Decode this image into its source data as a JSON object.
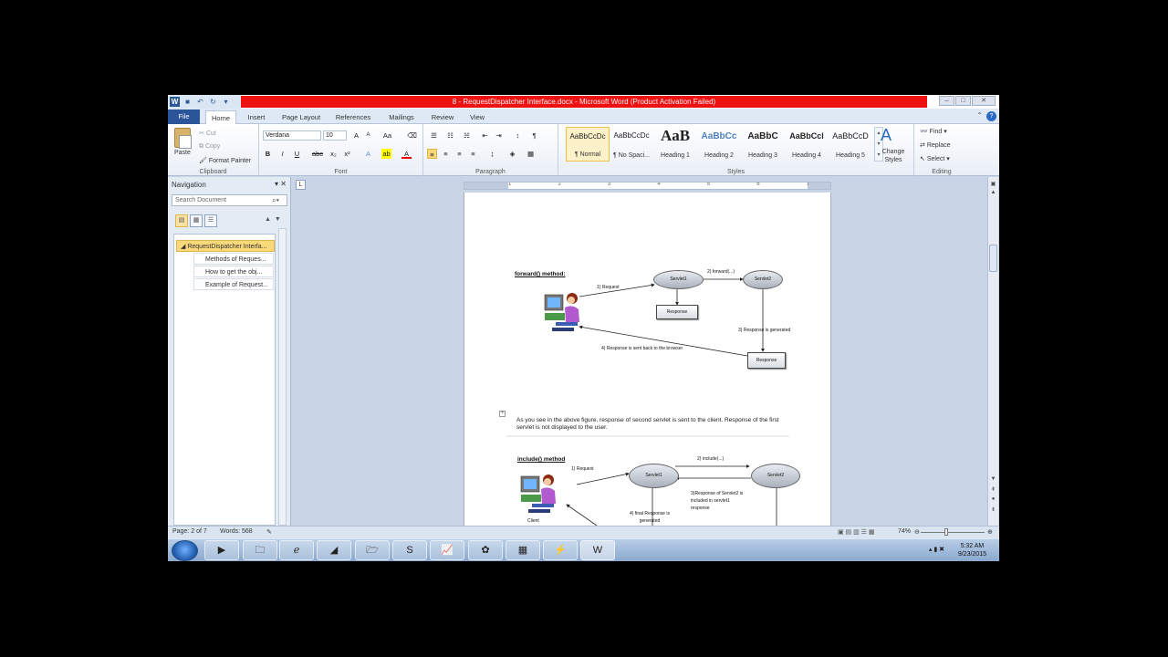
{
  "window": {
    "title": "8 - RequestDispatcher Interface.docx - Microsoft Word (Product Activation Failed)",
    "min_icon": "minimize-icon",
    "max_icon": "maximize-icon",
    "close_icon": "close-icon"
  },
  "tabs": [
    "File",
    "Home",
    "Insert",
    "Page Layout",
    "References",
    "Mailings",
    "Review",
    "View"
  ],
  "ribbon": {
    "clipboard": {
      "paste": "Paste",
      "cut": "Cut",
      "copy": "Copy",
      "format_painter": "Format Painter",
      "label": "Clipboard"
    },
    "font": {
      "family": "Verdana",
      "size": "10",
      "label": "Font",
      "bold": "B",
      "italic": "I",
      "underline": "U",
      "strike": "abc",
      "sub": "x₂",
      "sup": "x²"
    },
    "paragraph": {
      "label": "Paragraph",
      "pilcrow": "¶"
    },
    "styles": {
      "label": "Styles",
      "items": [
        {
          "preview": "AaBbCcDc",
          "name": "¶ Normal"
        },
        {
          "preview": "AaBbCcDc",
          "name": "¶ No Spaci..."
        },
        {
          "preview": "AaB",
          "name": "Heading 1"
        },
        {
          "preview": "AaBbCc",
          "name": "Heading 2"
        },
        {
          "preview": "AaBbC",
          "name": "Heading 3"
        },
        {
          "preview": "AaBbCcl",
          "name": "Heading 4"
        },
        {
          "preview": "AaBbCcD",
          "name": "Heading 5"
        }
      ],
      "change_styles": "Change Styles"
    },
    "editing": {
      "find": "Find",
      "replace": "Replace",
      "select": "Select",
      "label": "Editing"
    }
  },
  "navigation": {
    "title": "Navigation",
    "search_placeholder": "Search Document",
    "headings": [
      {
        "text": "RequestDispatcher Interfa...",
        "level": 1
      },
      {
        "text": "Methods of Reques...",
        "level": 2
      },
      {
        "text": "How to get the obj...",
        "level": 2
      },
      {
        "text": "Example of Request...",
        "level": 2
      }
    ]
  },
  "ruler": {
    "numbers": [
      "1",
      "2",
      "3",
      "4",
      "5",
      "6",
      "7"
    ]
  },
  "document": {
    "forward_title": "forward() method:",
    "forward_diagram": {
      "servlet1": "Servlet1",
      "servlet2": "Servlet2",
      "response1": "Response",
      "response2": "Response",
      "step1": "1) Request",
      "step2": "2) forward(...)",
      "step3": "3) Response is generated",
      "step4": "4) Response  is sent back to the browser"
    },
    "paragraph": "As you see in the above figure, response of second servlet is sent to the client. Response of the first servlet is not displayed to the user.",
    "include_title": "include() method",
    "include_diagram": {
      "servlet1": "Servlet1",
      "servlet2": "Servlet2",
      "step1": "1) Request",
      "step2": "2) include(...)",
      "step3": "3)Response of Servlet2 is included  in servlet1 response",
      "step4": "4) final Response is generated",
      "client": "Client"
    }
  },
  "status": {
    "page": "Page: 2 of 7",
    "words": "Words: 568",
    "zoom": "74%"
  },
  "taskbar": {
    "time": "5:32 AM",
    "date": "9/23/2015"
  }
}
